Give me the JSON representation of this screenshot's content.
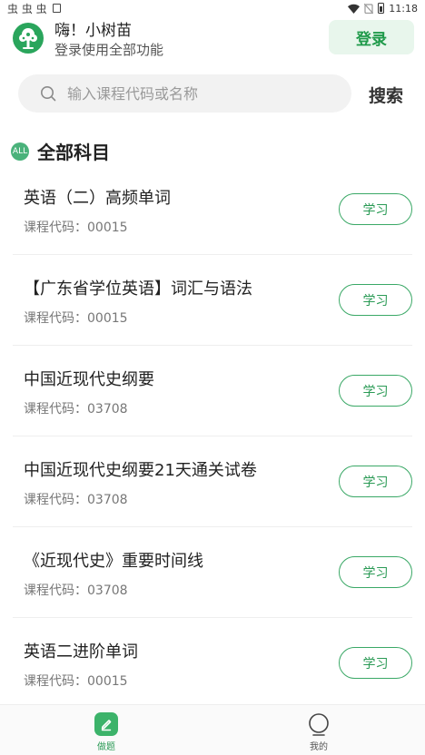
{
  "status_bar": {
    "notifications": "虫 虫 虫",
    "time": "11:18"
  },
  "header": {
    "greeting": "嗨！小树苗",
    "subtitle": "登录使用全部功能",
    "login_label": "登录"
  },
  "search": {
    "placeholder": "输入课程代码或名称",
    "button_label": "搜索"
  },
  "section": {
    "icon_text": "ALL",
    "title": "全部科目"
  },
  "courses": [
    {
      "name": "英语（二）高频单词",
      "code": "课程代码：00015",
      "action": "学习"
    },
    {
      "name": "【广东省学位英语】词汇与语法",
      "code": "课程代码：00015",
      "action": "学习"
    },
    {
      "name": "中国近现代史纲要",
      "code": "课程代码：03708",
      "action": "学习"
    },
    {
      "name": "中国近现代史纲要21天通关试卷",
      "code": "课程代码：03708",
      "action": "学习"
    },
    {
      "name": "《近现代史》重要时间线",
      "code": "课程代码：03708",
      "action": "学习"
    },
    {
      "name": "英语二进阶单词",
      "code": "课程代码：00015",
      "action": "学习"
    }
  ],
  "tabbar": {
    "tabs": [
      {
        "label": "做题",
        "icon": "pencil-icon",
        "active": true
      },
      {
        "label": "我的",
        "icon": "user-icon",
        "active": false
      }
    ]
  },
  "colors": {
    "accent": "#2a9a55",
    "accent_light": "#e8f6ec"
  }
}
